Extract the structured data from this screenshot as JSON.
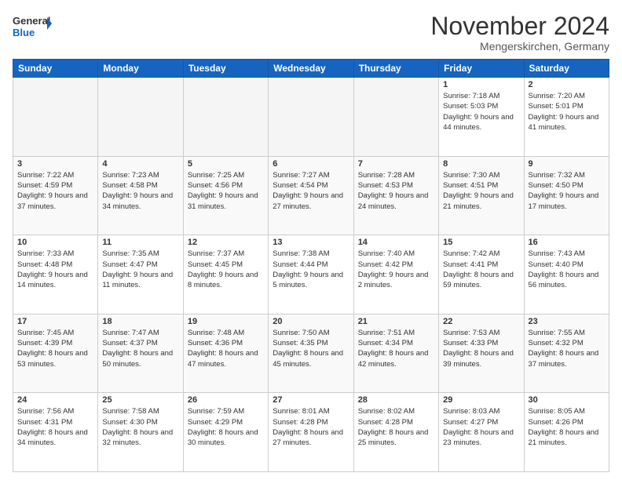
{
  "logo": {
    "line1": "General",
    "line2": "Blue"
  },
  "header": {
    "title": "November 2024",
    "subtitle": "Mengerskirchen, Germany"
  },
  "weekdays": [
    "Sunday",
    "Monday",
    "Tuesday",
    "Wednesday",
    "Thursday",
    "Friday",
    "Saturday"
  ],
  "weeks": [
    [
      {
        "day": "",
        "info": ""
      },
      {
        "day": "",
        "info": ""
      },
      {
        "day": "",
        "info": ""
      },
      {
        "day": "",
        "info": ""
      },
      {
        "day": "",
        "info": ""
      },
      {
        "day": "1",
        "info": "Sunrise: 7:18 AM\nSunset: 5:03 PM\nDaylight: 9 hours and 44 minutes."
      },
      {
        "day": "2",
        "info": "Sunrise: 7:20 AM\nSunset: 5:01 PM\nDaylight: 9 hours and 41 minutes."
      }
    ],
    [
      {
        "day": "3",
        "info": "Sunrise: 7:22 AM\nSunset: 4:59 PM\nDaylight: 9 hours and 37 minutes."
      },
      {
        "day": "4",
        "info": "Sunrise: 7:23 AM\nSunset: 4:58 PM\nDaylight: 9 hours and 34 minutes."
      },
      {
        "day": "5",
        "info": "Sunrise: 7:25 AM\nSunset: 4:56 PM\nDaylight: 9 hours and 31 minutes."
      },
      {
        "day": "6",
        "info": "Sunrise: 7:27 AM\nSunset: 4:54 PM\nDaylight: 9 hours and 27 minutes."
      },
      {
        "day": "7",
        "info": "Sunrise: 7:28 AM\nSunset: 4:53 PM\nDaylight: 9 hours and 24 minutes."
      },
      {
        "day": "8",
        "info": "Sunrise: 7:30 AM\nSunset: 4:51 PM\nDaylight: 9 hours and 21 minutes."
      },
      {
        "day": "9",
        "info": "Sunrise: 7:32 AM\nSunset: 4:50 PM\nDaylight: 9 hours and 17 minutes."
      }
    ],
    [
      {
        "day": "10",
        "info": "Sunrise: 7:33 AM\nSunset: 4:48 PM\nDaylight: 9 hours and 14 minutes."
      },
      {
        "day": "11",
        "info": "Sunrise: 7:35 AM\nSunset: 4:47 PM\nDaylight: 9 hours and 11 minutes."
      },
      {
        "day": "12",
        "info": "Sunrise: 7:37 AM\nSunset: 4:45 PM\nDaylight: 9 hours and 8 minutes."
      },
      {
        "day": "13",
        "info": "Sunrise: 7:38 AM\nSunset: 4:44 PM\nDaylight: 9 hours and 5 minutes."
      },
      {
        "day": "14",
        "info": "Sunrise: 7:40 AM\nSunset: 4:42 PM\nDaylight: 9 hours and 2 minutes."
      },
      {
        "day": "15",
        "info": "Sunrise: 7:42 AM\nSunset: 4:41 PM\nDaylight: 8 hours and 59 minutes."
      },
      {
        "day": "16",
        "info": "Sunrise: 7:43 AM\nSunset: 4:40 PM\nDaylight: 8 hours and 56 minutes."
      }
    ],
    [
      {
        "day": "17",
        "info": "Sunrise: 7:45 AM\nSunset: 4:39 PM\nDaylight: 8 hours and 53 minutes."
      },
      {
        "day": "18",
        "info": "Sunrise: 7:47 AM\nSunset: 4:37 PM\nDaylight: 8 hours and 50 minutes."
      },
      {
        "day": "19",
        "info": "Sunrise: 7:48 AM\nSunset: 4:36 PM\nDaylight: 8 hours and 47 minutes."
      },
      {
        "day": "20",
        "info": "Sunrise: 7:50 AM\nSunset: 4:35 PM\nDaylight: 8 hours and 45 minutes."
      },
      {
        "day": "21",
        "info": "Sunrise: 7:51 AM\nSunset: 4:34 PM\nDaylight: 8 hours and 42 minutes."
      },
      {
        "day": "22",
        "info": "Sunrise: 7:53 AM\nSunset: 4:33 PM\nDaylight: 8 hours and 39 minutes."
      },
      {
        "day": "23",
        "info": "Sunrise: 7:55 AM\nSunset: 4:32 PM\nDaylight: 8 hours and 37 minutes."
      }
    ],
    [
      {
        "day": "24",
        "info": "Sunrise: 7:56 AM\nSunset: 4:31 PM\nDaylight: 8 hours and 34 minutes."
      },
      {
        "day": "25",
        "info": "Sunrise: 7:58 AM\nSunset: 4:30 PM\nDaylight: 8 hours and 32 minutes."
      },
      {
        "day": "26",
        "info": "Sunrise: 7:59 AM\nSunset: 4:29 PM\nDaylight: 8 hours and 30 minutes."
      },
      {
        "day": "27",
        "info": "Sunrise: 8:01 AM\nSunset: 4:28 PM\nDaylight: 8 hours and 27 minutes."
      },
      {
        "day": "28",
        "info": "Sunrise: 8:02 AM\nSunset: 4:28 PM\nDaylight: 8 hours and 25 minutes."
      },
      {
        "day": "29",
        "info": "Sunrise: 8:03 AM\nSunset: 4:27 PM\nDaylight: 8 hours and 23 minutes."
      },
      {
        "day": "30",
        "info": "Sunrise: 8:05 AM\nSunset: 4:26 PM\nDaylight: 8 hours and 21 minutes."
      }
    ]
  ]
}
